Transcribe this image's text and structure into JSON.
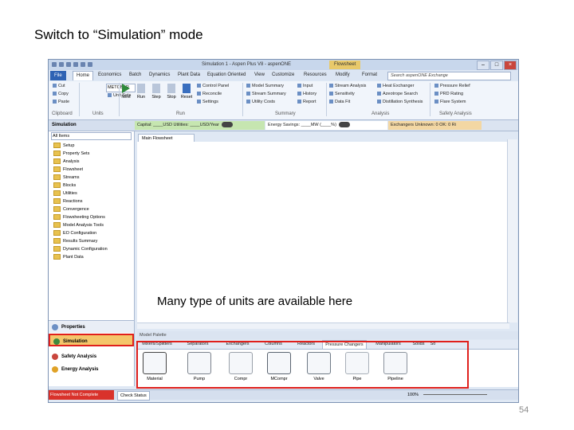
{
  "slide": {
    "title": "Switch to “Simulation” mode",
    "annotation": "Many type of units are available here",
    "page_number": "54"
  },
  "window": {
    "title": "Simulation 1 - Aspen Plus V8 - aspenONE",
    "context_tab": "Flowsheet",
    "controls": [
      "–",
      "□",
      "×"
    ]
  },
  "menu": {
    "items": [
      "File",
      "Home",
      "Economics",
      "Batch",
      "Dynamics",
      "Plant Data",
      "Equation Oriented",
      "View",
      "Customize",
      "Resources",
      "Modify",
      "Format"
    ],
    "search_placeholder": "Search aspenONE Exchange"
  },
  "ribbon": {
    "clipboard": {
      "cut": "Cut",
      "copy": "Copy",
      "paste": "Paste",
      "label": "Clipboard"
    },
    "units": {
      "value": "METCBAR",
      "unit_sets": "Unit Sets",
      "label": "Units"
    },
    "run": {
      "buttons": [
        "Next",
        "Run",
        "Step",
        "Stop",
        "Reset"
      ],
      "label": "Run"
    },
    "run_extra": [
      "Control Panel",
      "Reconcile",
      "Settings"
    ],
    "summary": {
      "items": [
        "Model Summary",
        "Stream Summary",
        "Utility Costs",
        "Input",
        "History",
        "Report"
      ],
      "label": "Summary"
    },
    "analysis": {
      "items": [
        "Stream Analysis",
        "Sensitivity",
        "Data Fit",
        "Heat Exchanger",
        "Azeotrope Search",
        "Distillation Synthesis"
      ],
      "label": "Analysis"
    },
    "safety": {
      "items": [
        "Pressure Relief",
        "PRD Rating",
        "Flare System"
      ],
      "label": "Safety Analysis"
    }
  },
  "status_strip": {
    "nav_header": "Simulation",
    "costs": "Capital: ____USD  Utilities: ____USD/Year",
    "energy": "Energy Savings: ____MW (____%)",
    "exchangers": "Exchangers   Unknown: 0  OK: 0  Ri"
  },
  "navigation": {
    "filter": "All Items",
    "tree": [
      "Setup",
      "Property Sets",
      "Analysis",
      "Flowsheet",
      "Streams",
      "Blocks",
      "Utilities",
      "Reactions",
      "Convergence",
      "Flowsheeting Options",
      "Model Analysis Tools",
      "EO Configuration",
      "Results Summary",
      "Dynamic Configuration",
      "Plant Data"
    ],
    "panes": {
      "properties": "Properties",
      "simulation": "Simulation",
      "safety": "Safety Analysis",
      "energy": "Energy Analysis"
    }
  },
  "main": {
    "tab": "Main Flowsheet"
  },
  "palette": {
    "title": "Model Palette",
    "tabs": [
      "Mixers/Splitters",
      "Separators",
      "Exchangers",
      "Columns",
      "Reactors",
      "Pressure Changers",
      "Manipulators",
      "Solids",
      "So"
    ],
    "active_tab": "Pressure Changers",
    "items": [
      "Material",
      "Pump",
      "Compr",
      "MCompr",
      "Valve",
      "Pipe",
      "Pipeline"
    ]
  },
  "statusbar": {
    "error": "Flowsheet Not Complete",
    "check": "Check Status",
    "zoom": "100%"
  },
  "colors": {
    "highlight": "#e0201c",
    "file_tab": "#2f63b4",
    "simulation_pane": "#f4c66b",
    "error": "#d9322b"
  }
}
